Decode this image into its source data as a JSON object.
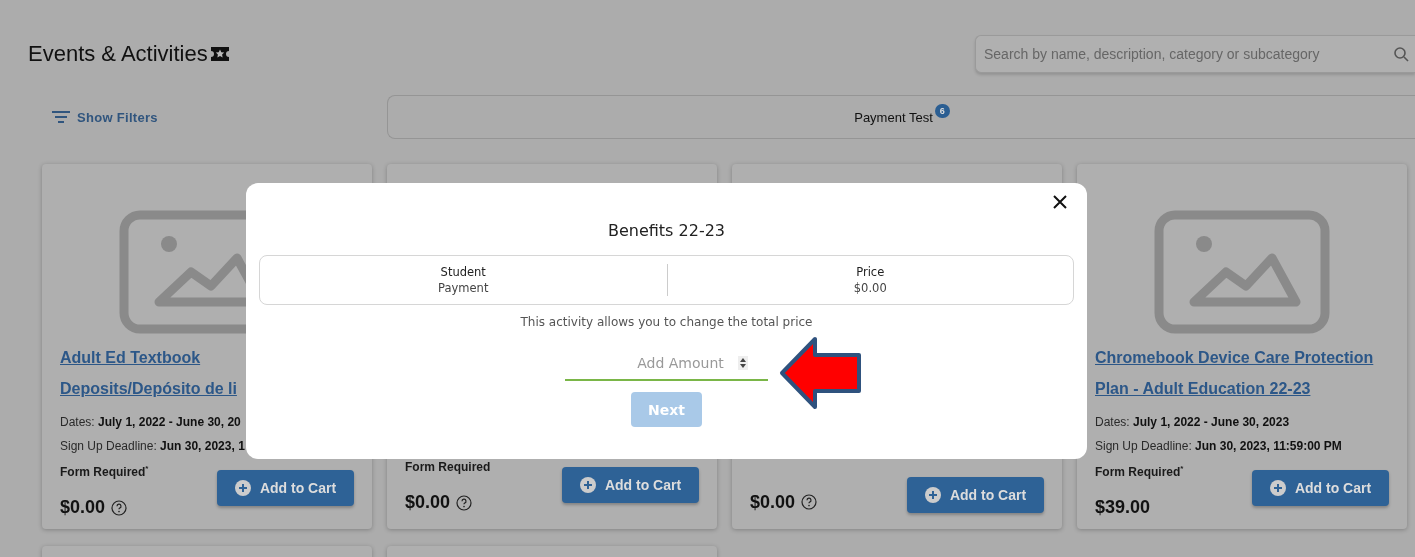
{
  "header": {
    "title": "Events & Activities"
  },
  "search": {
    "placeholder": "Search by name, description, category or subcategory"
  },
  "filters_button": {
    "label": "Show Filters"
  },
  "category_tabs": [
    {
      "label": "Payment Test",
      "count": "6"
    }
  ],
  "cards": [
    {
      "title": "Adult Ed Textbook\nDeposits/Depósito de li",
      "dates_label": "Dates:",
      "dates": "July 1, 2022 - June 30, 20",
      "deadline_label": "Sign Up Deadline:",
      "deadline": "Jun 30, 2023, 1",
      "form": "Form Required$^{*}$",
      "price": "$0.00",
      "price_info": true,
      "button": "Add to Cart"
    },
    {
      "form": "Form Required",
      "price": "$0.00",
      "price_info": true,
      "button": "Add to Cart"
    },
    {
      "price": "$0.00",
      "price_info": true,
      "button": "Add to Cart"
    },
    {
      "title": "Chromebook Device Care Protection Plan - Adult Education 22-23",
      "dates_label": "Dates:",
      "dates": "July 1, 2022 - June 30, 2023",
      "deadline_label": "Sign Up Deadline:",
      "deadline": "Jun 30, 2023, 11:59:00 PM",
      "form": "Form Required$^{*}$",
      "price": "$39.00",
      "price_info": false,
      "button": "Add to Cart"
    }
  ],
  "modal": {
    "title": "Benefits 22-23",
    "columns": [
      {
        "label": "Student",
        "value": "Payment"
      },
      {
        "label": "Price",
        "value": "$0.00"
      }
    ],
    "note": "This activity allows you to change the total price",
    "amount_field": {
      "placeholder": "Add Amount"
    },
    "next_button": {
      "label": "Next",
      "disabled": true
    }
  }
}
